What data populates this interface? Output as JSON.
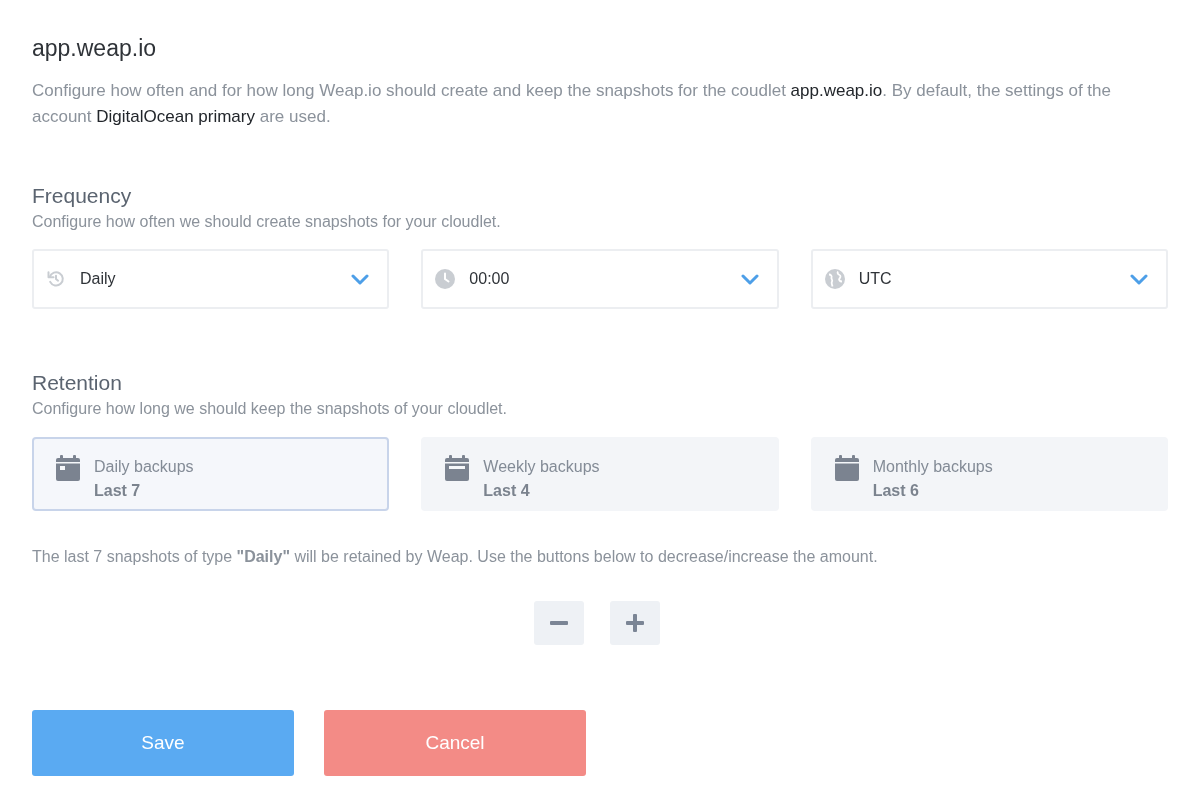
{
  "title": "app.weap.io",
  "description": [
    {
      "text": "Configure how often and for how long Weap.io should create and keep the snapshots for the coudlet ",
      "highlight": false
    },
    {
      "text": "app.weap.io",
      "highlight": true
    },
    {
      "text": ". By default, the settings of the account ",
      "highlight": false
    },
    {
      "text": "DigitalOcean primary",
      "highlight": true
    },
    {
      "text": " are used.",
      "highlight": false
    }
  ],
  "frequency": {
    "heading": "Frequency",
    "subtitle": "Configure how often we should create snapshots for your cloudlet.",
    "selects": [
      {
        "kind": "interval",
        "value": "Daily"
      },
      {
        "kind": "time",
        "value": "00:00"
      },
      {
        "kind": "timezone",
        "value": "UTC"
      }
    ]
  },
  "retention": {
    "heading": "Retention",
    "subtitle": "Configure how long we should keep the snapshots of your cloudlet.",
    "cards": [
      {
        "kind": "daily",
        "label": "Daily backups",
        "amount": "Last 7",
        "selected": true
      },
      {
        "kind": "weekly",
        "label": "Weekly backups",
        "amount": "Last 4",
        "selected": false
      },
      {
        "kind": "monthly",
        "label": "Monthly backups",
        "amount": "Last 6",
        "selected": false
      }
    ],
    "info": "The last 7 snapshots of type **\"Daily\"** will be retained by Weap. Use the buttons below to decrease/increase the amount.",
    "steppers": [
      {
        "kind": "decrease"
      },
      {
        "kind": "increase"
      }
    ]
  },
  "actions": [
    {
      "kind": "primary",
      "label": "Save"
    },
    {
      "kind": "danger",
      "label": "Cancel"
    }
  ]
}
